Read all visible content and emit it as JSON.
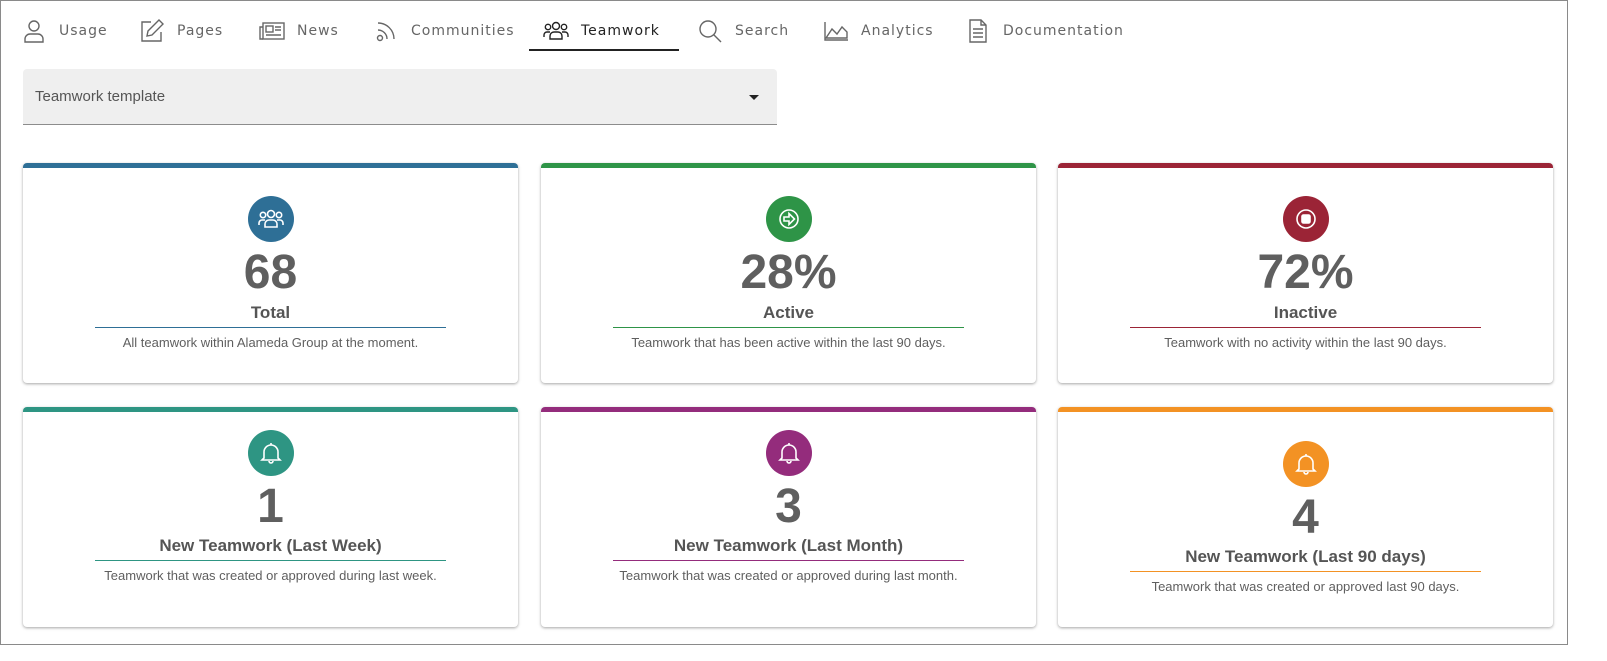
{
  "tabs": [
    {
      "label": "Usage",
      "icon": "user-icon"
    },
    {
      "label": "Pages",
      "icon": "edit-icon"
    },
    {
      "label": "News",
      "icon": "newspaper-icon"
    },
    {
      "label": "Communities",
      "icon": "rss-icon"
    },
    {
      "label": "Teamwork",
      "icon": "team-icon",
      "active": true
    },
    {
      "label": "Search",
      "icon": "search-icon"
    },
    {
      "label": "Analytics",
      "icon": "area-chart-icon"
    },
    {
      "label": "Documentation",
      "icon": "document-icon"
    }
  ],
  "filter": {
    "value": "Teamwork template"
  },
  "cards": [
    {
      "value": "68",
      "title": "Total",
      "desc": "All teamwork within Alameda Group at the moment.",
      "color": "#2e6f96",
      "icon": "team-icon"
    },
    {
      "value": "28%",
      "title": "Active",
      "desc": "Teamwork that has been active within the last 90 days.",
      "color": "#2e9447",
      "icon": "arrow-right-circle-icon"
    },
    {
      "value": "72%",
      "title": "Inactive",
      "desc": "Teamwork with no activity within the last 90 days.",
      "color": "#9b2436",
      "icon": "stop-circle-icon"
    },
    {
      "value": "1",
      "title": "New Teamwork (Last Week)",
      "desc": "Teamwork that was created or approved during last week.",
      "color": "#2e9583",
      "icon": "bell-icon"
    },
    {
      "value": "3",
      "title": "New Teamwork (Last Month)",
      "desc": "Teamwork that was created or approved during last month.",
      "color": "#942c7c",
      "icon": "bell-icon"
    },
    {
      "value": "4",
      "title": "New Teamwork (Last 90 days)",
      "desc": "Teamwork that was created or approved last 90 days.",
      "color": "#f39224",
      "icon": "bell-icon"
    }
  ]
}
